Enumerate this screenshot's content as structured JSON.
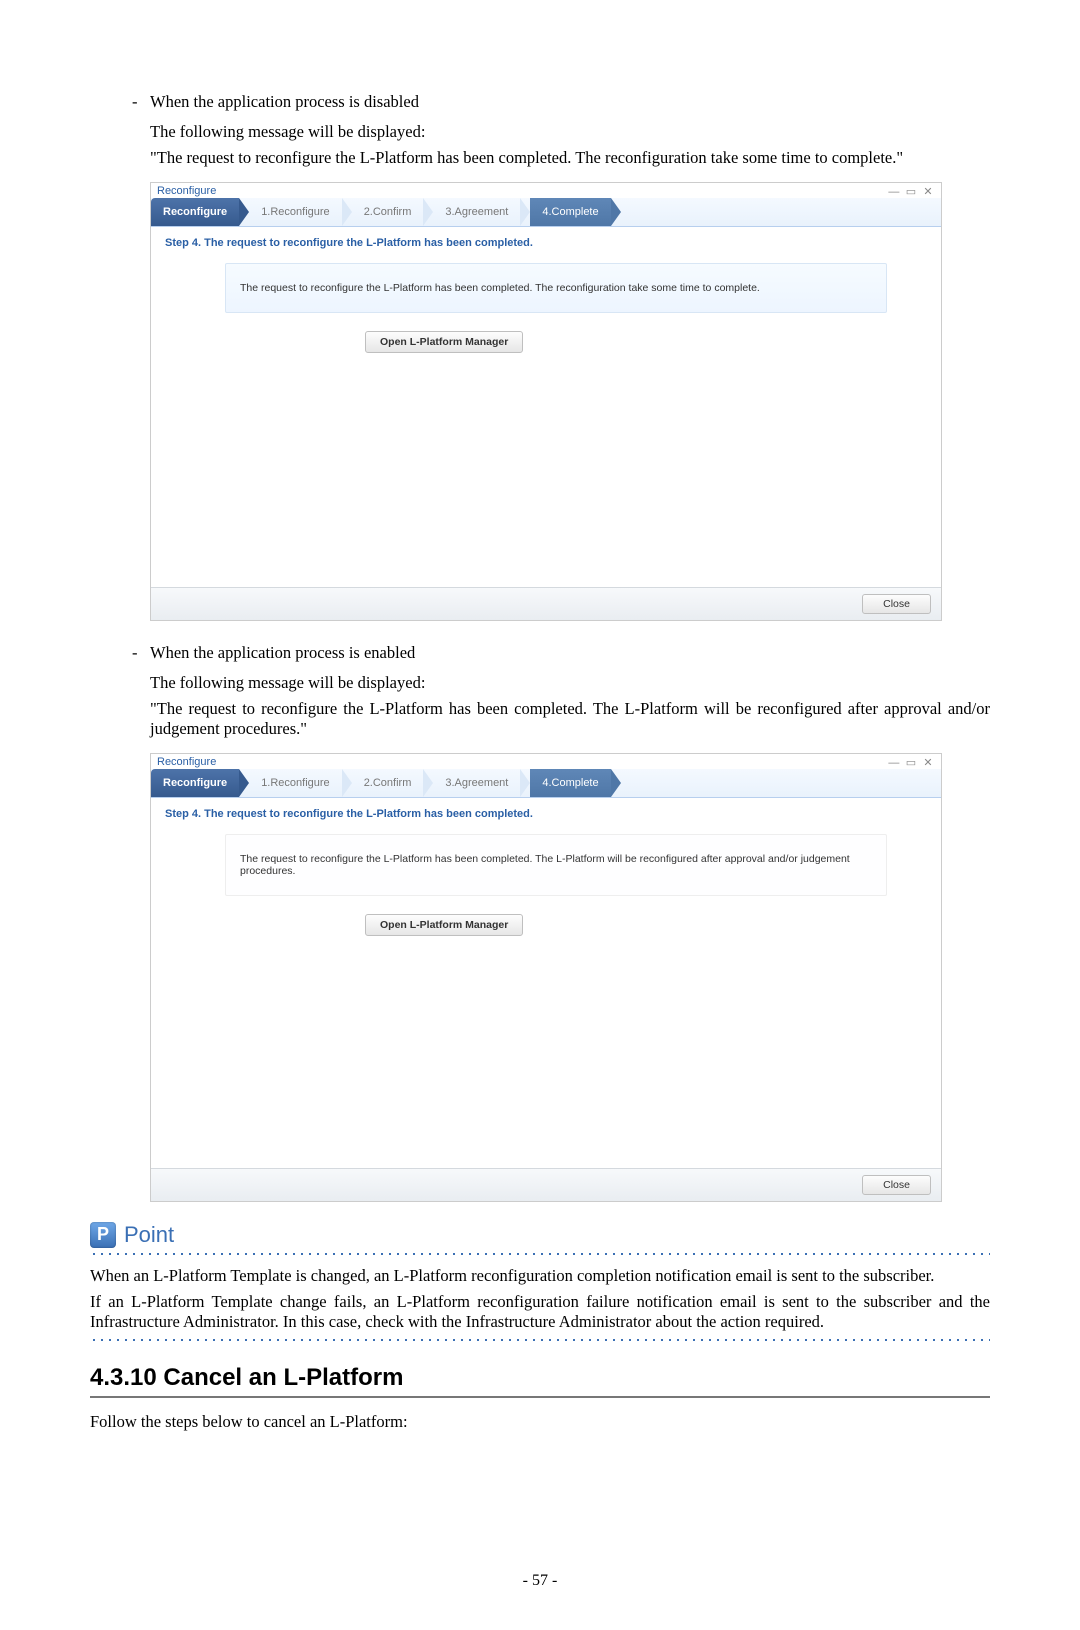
{
  "bullets": {
    "disabled": "When the application process is disabled",
    "enabled": "When the application process is enabled"
  },
  "followup": "The following message will be displayed:",
  "quote_disabled": "\"The request to reconfigure the L-Platform has been completed. The reconfiguration take some time to complete.\"",
  "quote_enabled": "\"The request to reconfigure the L-Platform has been completed. The L-Platform will be reconfigured after approval and/or judgement procedures.\"",
  "shot": {
    "window_title": "Reconfigure",
    "tabs": {
      "active": "Reconfigure",
      "t1": "1.Reconfigure",
      "t2": "2.Confirm",
      "t3": "3.Agreement",
      "t4": "4.Complete"
    },
    "step_line": "Step 4. The request to reconfigure the L-Platform has been completed.",
    "msg_disabled": "The request to reconfigure the L-Platform has been completed. The reconfiguration take some time to complete.",
    "msg_enabled": "The request to reconfigure the L-Platform has been completed. The L-Platform will be reconfigured after approval and/or judgement procedures.",
    "open_btn": "Open L-Platform Manager",
    "close_btn": "Close"
  },
  "point": {
    "label": "Point",
    "p1": "When an L-Platform Template is changed, an L-Platform reconfiguration completion notification email is sent to the subscriber.",
    "p2": "If an L-Platform Template change fails, an L-Platform reconfiguration failure notification email is sent to the subscriber and the Infrastructure Administrator. In this case, check with the Infrastructure Administrator about the action required."
  },
  "section": {
    "num_title": "4.3.10 Cancel an L-Platform",
    "intro": "Follow the steps below to cancel an L-Platform:"
  },
  "page_number": "- 57 -"
}
